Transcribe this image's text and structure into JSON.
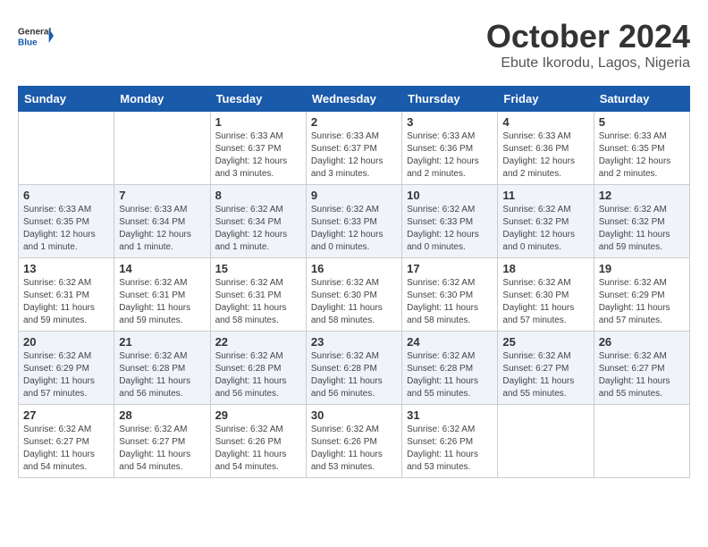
{
  "header": {
    "logo_line1": "General",
    "logo_line2": "Blue",
    "month": "October 2024",
    "location": "Ebute Ikorodu, Lagos, Nigeria"
  },
  "days_of_week": [
    "Sunday",
    "Monday",
    "Tuesday",
    "Wednesday",
    "Thursday",
    "Friday",
    "Saturday"
  ],
  "weeks": [
    [
      {
        "day": "",
        "info": ""
      },
      {
        "day": "",
        "info": ""
      },
      {
        "day": "1",
        "info": "Sunrise: 6:33 AM\nSunset: 6:37 PM\nDaylight: 12 hours\nand 3 minutes."
      },
      {
        "day": "2",
        "info": "Sunrise: 6:33 AM\nSunset: 6:37 PM\nDaylight: 12 hours\nand 3 minutes."
      },
      {
        "day": "3",
        "info": "Sunrise: 6:33 AM\nSunset: 6:36 PM\nDaylight: 12 hours\nand 2 minutes."
      },
      {
        "day": "4",
        "info": "Sunrise: 6:33 AM\nSunset: 6:36 PM\nDaylight: 12 hours\nand 2 minutes."
      },
      {
        "day": "5",
        "info": "Sunrise: 6:33 AM\nSunset: 6:35 PM\nDaylight: 12 hours\nand 2 minutes."
      }
    ],
    [
      {
        "day": "6",
        "info": "Sunrise: 6:33 AM\nSunset: 6:35 PM\nDaylight: 12 hours\nand 1 minute."
      },
      {
        "day": "7",
        "info": "Sunrise: 6:33 AM\nSunset: 6:34 PM\nDaylight: 12 hours\nand 1 minute."
      },
      {
        "day": "8",
        "info": "Sunrise: 6:32 AM\nSunset: 6:34 PM\nDaylight: 12 hours\nand 1 minute."
      },
      {
        "day": "9",
        "info": "Sunrise: 6:32 AM\nSunset: 6:33 PM\nDaylight: 12 hours\nand 0 minutes."
      },
      {
        "day": "10",
        "info": "Sunrise: 6:32 AM\nSunset: 6:33 PM\nDaylight: 12 hours\nand 0 minutes."
      },
      {
        "day": "11",
        "info": "Sunrise: 6:32 AM\nSunset: 6:32 PM\nDaylight: 12 hours\nand 0 minutes."
      },
      {
        "day": "12",
        "info": "Sunrise: 6:32 AM\nSunset: 6:32 PM\nDaylight: 11 hours\nand 59 minutes."
      }
    ],
    [
      {
        "day": "13",
        "info": "Sunrise: 6:32 AM\nSunset: 6:31 PM\nDaylight: 11 hours\nand 59 minutes."
      },
      {
        "day": "14",
        "info": "Sunrise: 6:32 AM\nSunset: 6:31 PM\nDaylight: 11 hours\nand 59 minutes."
      },
      {
        "day": "15",
        "info": "Sunrise: 6:32 AM\nSunset: 6:31 PM\nDaylight: 11 hours\nand 58 minutes."
      },
      {
        "day": "16",
        "info": "Sunrise: 6:32 AM\nSunset: 6:30 PM\nDaylight: 11 hours\nand 58 minutes."
      },
      {
        "day": "17",
        "info": "Sunrise: 6:32 AM\nSunset: 6:30 PM\nDaylight: 11 hours\nand 58 minutes."
      },
      {
        "day": "18",
        "info": "Sunrise: 6:32 AM\nSunset: 6:30 PM\nDaylight: 11 hours\nand 57 minutes."
      },
      {
        "day": "19",
        "info": "Sunrise: 6:32 AM\nSunset: 6:29 PM\nDaylight: 11 hours\nand 57 minutes."
      }
    ],
    [
      {
        "day": "20",
        "info": "Sunrise: 6:32 AM\nSunset: 6:29 PM\nDaylight: 11 hours\nand 57 minutes."
      },
      {
        "day": "21",
        "info": "Sunrise: 6:32 AM\nSunset: 6:28 PM\nDaylight: 11 hours\nand 56 minutes."
      },
      {
        "day": "22",
        "info": "Sunrise: 6:32 AM\nSunset: 6:28 PM\nDaylight: 11 hours\nand 56 minutes."
      },
      {
        "day": "23",
        "info": "Sunrise: 6:32 AM\nSunset: 6:28 PM\nDaylight: 11 hours\nand 56 minutes."
      },
      {
        "day": "24",
        "info": "Sunrise: 6:32 AM\nSunset: 6:28 PM\nDaylight: 11 hours\nand 55 minutes."
      },
      {
        "day": "25",
        "info": "Sunrise: 6:32 AM\nSunset: 6:27 PM\nDaylight: 11 hours\nand 55 minutes."
      },
      {
        "day": "26",
        "info": "Sunrise: 6:32 AM\nSunset: 6:27 PM\nDaylight: 11 hours\nand 55 minutes."
      }
    ],
    [
      {
        "day": "27",
        "info": "Sunrise: 6:32 AM\nSunset: 6:27 PM\nDaylight: 11 hours\nand 54 minutes."
      },
      {
        "day": "28",
        "info": "Sunrise: 6:32 AM\nSunset: 6:27 PM\nDaylight: 11 hours\nand 54 minutes."
      },
      {
        "day": "29",
        "info": "Sunrise: 6:32 AM\nSunset: 6:26 PM\nDaylight: 11 hours\nand 54 minutes."
      },
      {
        "day": "30",
        "info": "Sunrise: 6:32 AM\nSunset: 6:26 PM\nDaylight: 11 hours\nand 53 minutes."
      },
      {
        "day": "31",
        "info": "Sunrise: 6:32 AM\nSunset: 6:26 PM\nDaylight: 11 hours\nand 53 minutes."
      },
      {
        "day": "",
        "info": ""
      },
      {
        "day": "",
        "info": ""
      }
    ]
  ]
}
